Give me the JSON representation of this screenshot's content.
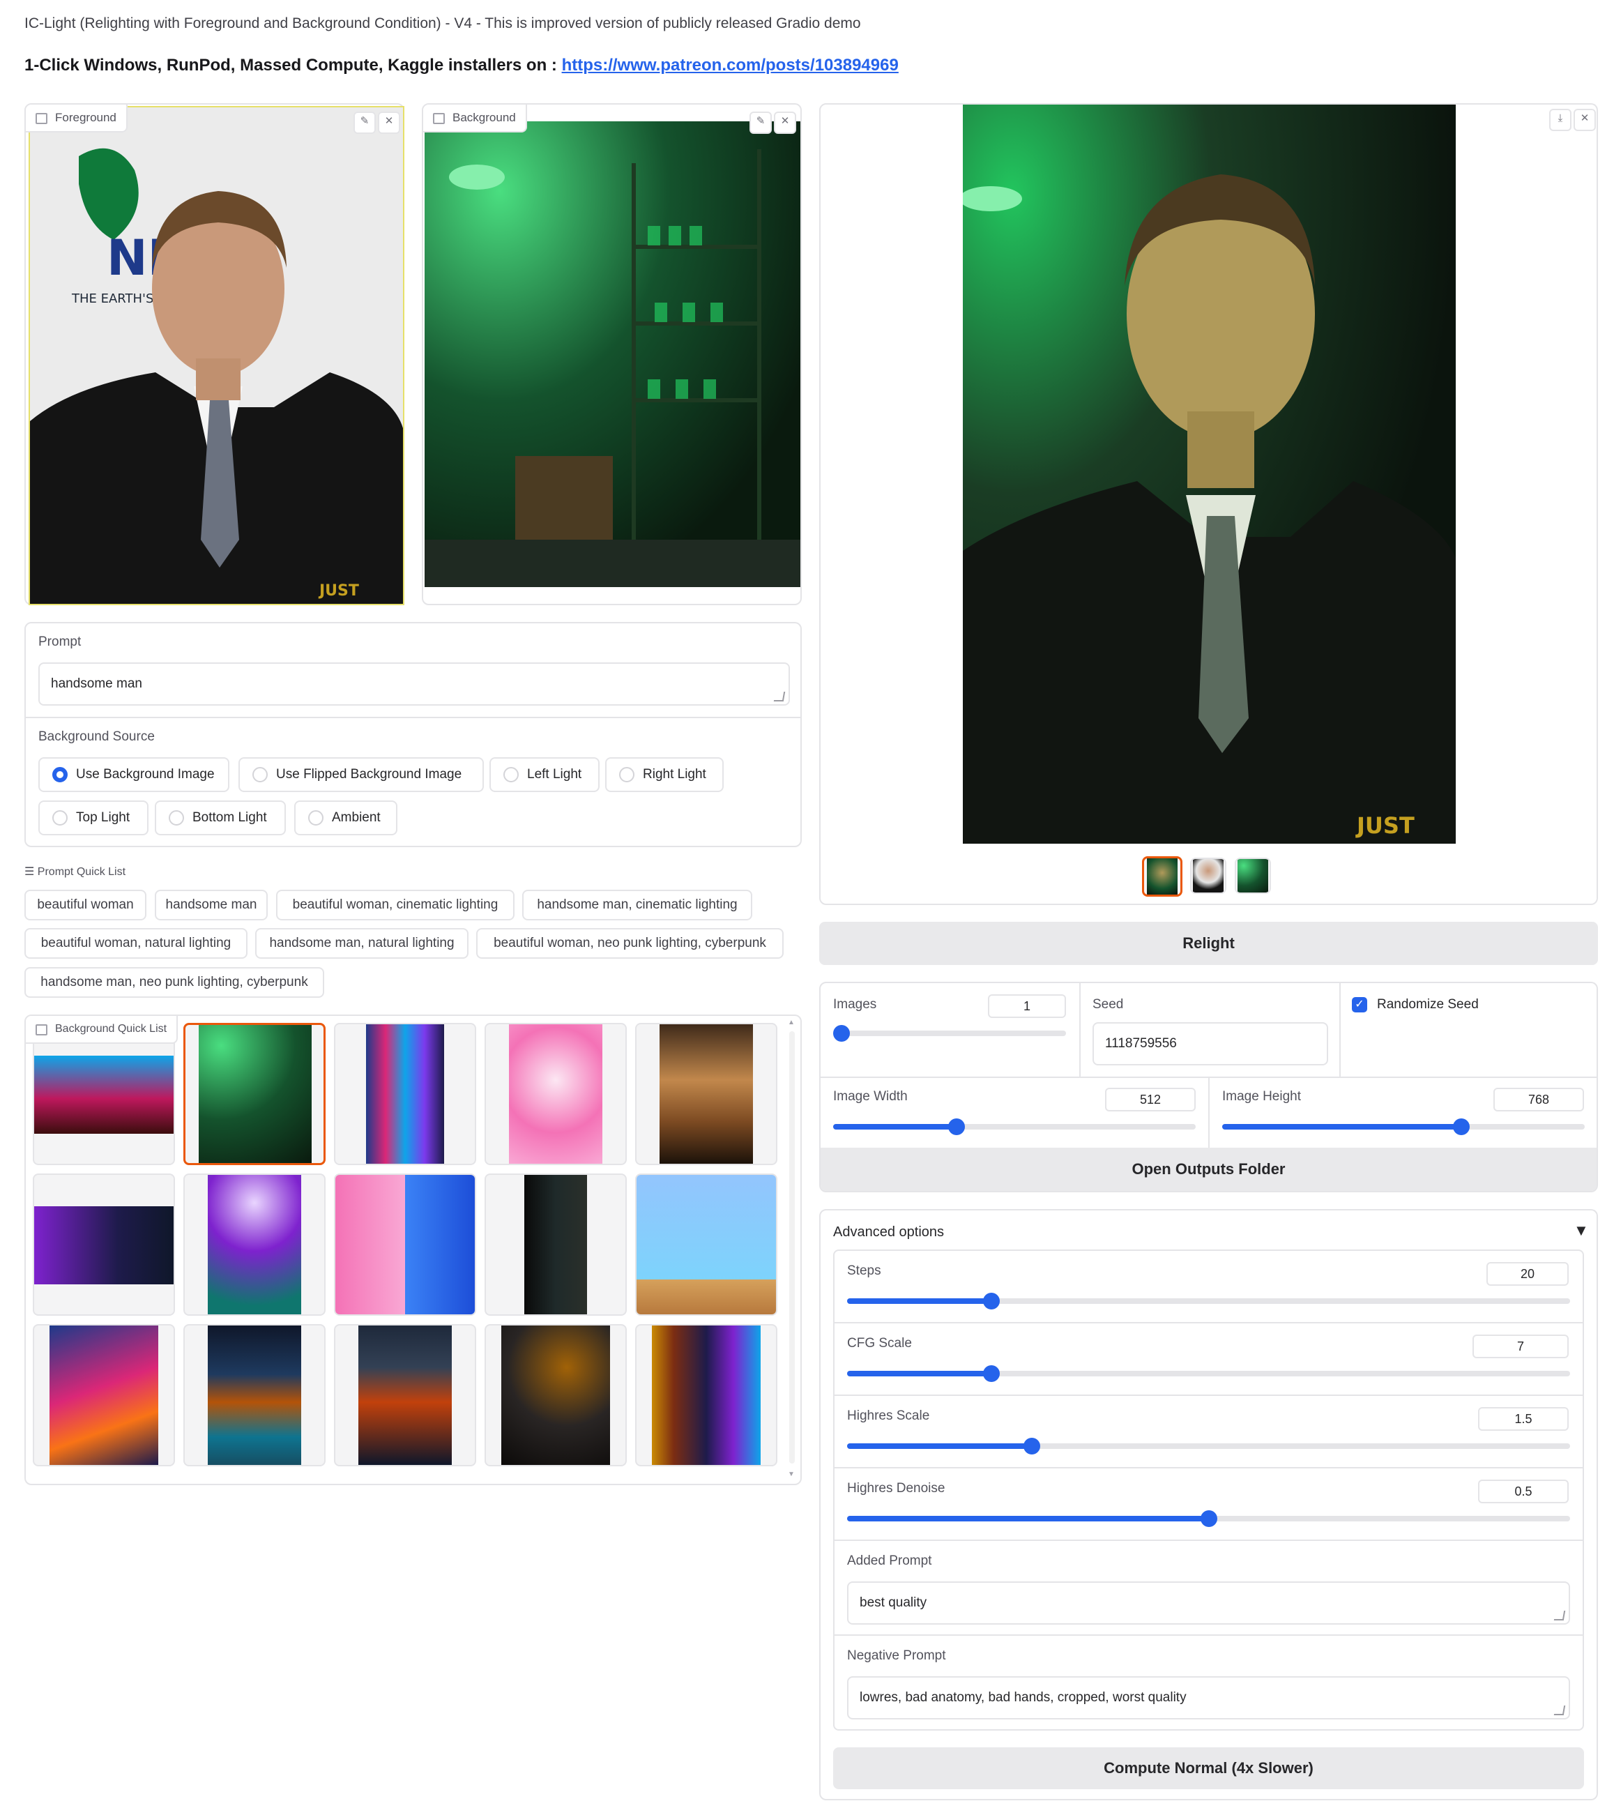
{
  "header": {
    "title": "IC-Light (Relighting with Foreground and Background Condition) - V4 - This is improved version of publicly released Gradio demo",
    "installers_text": "1-Click Windows, RunPod, Massed Compute, Kaggle installers on : ",
    "installers_link": "https://www.patreon.com/posts/103894969"
  },
  "foreground": {
    "label": "Foreground",
    "watermark": "JUST JARED"
  },
  "background": {
    "label": "Background"
  },
  "prompt": {
    "label": "Prompt",
    "value": "handsome man"
  },
  "background_source": {
    "label": "Background Source",
    "options": [
      "Use Background Image",
      "Use Flipped Background Image",
      "Left Light",
      "Right Light",
      "Top Light",
      "Bottom Light",
      "Ambient"
    ],
    "selected": "Use Background Image"
  },
  "prompt_quick_list": {
    "label": "Prompt Quick List",
    "items": [
      "beautiful woman",
      "handsome man",
      "beautiful woman, cinematic lighting",
      "handsome man, cinematic lighting",
      "beautiful woman, natural lighting",
      "handsome man, natural lighting",
      "beautiful woman, neo punk lighting, cyberpunk",
      "handsome man, neo punk lighting, cyberpunk"
    ]
  },
  "background_quick_list": {
    "label": "Background Quick List",
    "selected_index": 1
  },
  "output": {
    "watermark": "JUST JARED"
  },
  "relight_button": "Relight",
  "images": {
    "label": "Images",
    "value": "1",
    "fraction": 0.0
  },
  "seed": {
    "label": "Seed",
    "value": "1118759556"
  },
  "randomize_seed": {
    "label": "Randomize Seed",
    "checked": true
  },
  "image_width": {
    "label": "Image Width",
    "value": "512",
    "fraction": 0.34
  },
  "image_height": {
    "label": "Image Height",
    "value": "768",
    "fraction": 0.66
  },
  "open_outputs_button": "Open Outputs Folder",
  "advanced": {
    "label": "Advanced options",
    "steps": {
      "label": "Steps",
      "value": "20",
      "fraction": 0.2
    },
    "cfg_scale": {
      "label": "CFG Scale",
      "value": "7",
      "fraction": 0.2
    },
    "highres_scale": {
      "label": "Highres Scale",
      "value": "1.5",
      "fraction": 0.256
    },
    "highres_denoise": {
      "label": "Highres Denoise",
      "value": "0.5",
      "fraction": 0.5
    },
    "added_prompt": {
      "label": "Added Prompt",
      "value": "best quality"
    },
    "negative_prompt": {
      "label": "Negative Prompt",
      "value": "lowres, bad anatomy, bad hands, cropped, worst quality"
    }
  },
  "compute_button": "Compute Normal (4x Slower)",
  "icons": {
    "edit": "edit-icon",
    "close": "close-icon",
    "download": "download-icon",
    "image": "image-icon",
    "list": "list-icon",
    "expand": "triangle-down-icon",
    "check": "checkmark-icon"
  },
  "colors": {
    "accent": "#2563eb",
    "selection": "#ea580c",
    "border": "#e4e4e7",
    "button_bg": "#e9e9eb"
  }
}
